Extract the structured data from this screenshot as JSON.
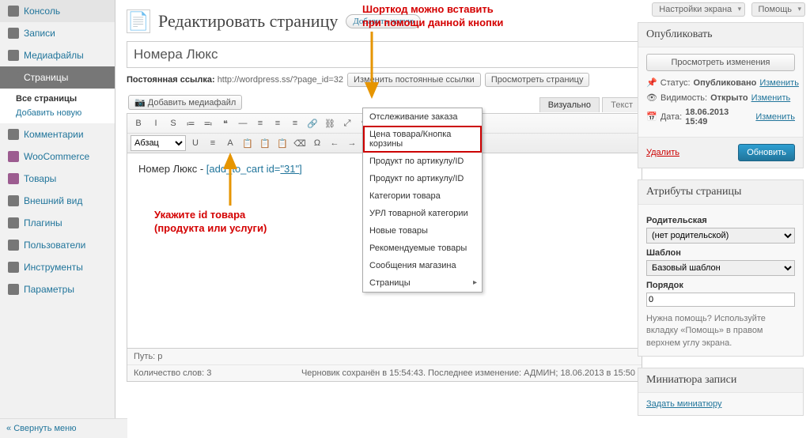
{
  "top": {
    "screen_options": "Настройки экрана",
    "help": "Помощь"
  },
  "menu": {
    "items": [
      {
        "label": "Консоль",
        "icon": "#777"
      },
      {
        "label": "Записи",
        "icon": "#777"
      },
      {
        "label": "Медиафайлы",
        "icon": "#777"
      },
      {
        "label": "Страницы",
        "icon": "#777",
        "current": true,
        "submenu": [
          {
            "label": "Все страницы",
            "b": true
          },
          {
            "label": "Добавить новую"
          }
        ]
      },
      {
        "label": "Комментарии",
        "icon": "#777"
      },
      {
        "label": "WooCommerce",
        "icon": "#9c5c90"
      },
      {
        "label": "Товары",
        "icon": "#9c5c90"
      },
      {
        "label": "Внешний вид",
        "icon": "#777"
      },
      {
        "label": "Плагины",
        "icon": "#777"
      },
      {
        "label": "Пользователи",
        "icon": "#777"
      },
      {
        "label": "Инструменты",
        "icon": "#777"
      },
      {
        "label": "Параметры",
        "icon": "#777"
      }
    ],
    "collapse": "Свернуть меню"
  },
  "header": {
    "title": "Редактировать страницу",
    "add_new": "Добавить новую"
  },
  "title_field": "Номера Люкс",
  "permalink": {
    "label": "Постоянная ссылка:",
    "url": "http://wordpress.ss/?page_id=32",
    "change": "Изменить постоянные ссылки",
    "view": "Просмотреть страницу"
  },
  "media_btn": "Добавить медиафайл",
  "tabs": {
    "visual": "Визуально",
    "text": "Текст"
  },
  "toolbar": {
    "row1": [
      "B",
      "I",
      "S",
      "≔",
      "≕",
      "❝",
      "―",
      "≡",
      "≡",
      "≡",
      "🔗",
      "⛓",
      "⤢",
      "✎",
      "✓",
      "▦",
      "⊞",
      "⊟"
    ],
    "format_select": "Абзац",
    "row2": [
      "U",
      "≡",
      "A",
      "📋",
      "📋",
      "📋",
      "⌫",
      "Ω",
      "←",
      "→",
      "¶",
      "↶",
      "↷",
      "?"
    ]
  },
  "content": {
    "text_before": "Номер Люкс - ",
    "shortcode_open": "[add_to_cart id=",
    "shortcode_id": "\"31\"",
    "shortcode_close": "]"
  },
  "dropdown": [
    {
      "label": "Отслеживание заказа"
    },
    {
      "label": "Цена товара/Кнопка корзины",
      "hl": true
    },
    {
      "label": "Продукт по артикулу/ID"
    },
    {
      "label": "Продукт по артикулу/ID"
    },
    {
      "label": "Категории товара"
    },
    {
      "label": "УРЛ товарной категории"
    },
    {
      "label": "Новые товары"
    },
    {
      "label": "Рекомендуемые товары"
    },
    {
      "label": "Сообщения магазина"
    },
    {
      "label": "Страницы",
      "arrow": true
    }
  ],
  "footer": {
    "path": "Путь: p",
    "words": "Количество слов: 3",
    "draft": "Черновик сохранён в 15:54:43. Последнее изменение: АДМИН; 18.06.2013 в 15:50"
  },
  "annotations": {
    "top": "Шорткод можно вставить\nпри помощи данной кнопки",
    "bottom": "Укажите id товара\n(продукта или услуги)"
  },
  "publish": {
    "box_title": "Опубликовать",
    "preview": "Просмотреть изменения",
    "status_label": "Статус:",
    "status_val": "Опубликовано",
    "status_edit": "Изменить",
    "vis_label": "Видимость:",
    "vis_val": "Открыто",
    "vis_edit": "Изменить",
    "date_label": "Дата:",
    "date_val": "18.06.2013 15:49",
    "date_edit": "Изменить",
    "delete": "Удалить",
    "update": "Обновить"
  },
  "attrs": {
    "box_title": "Атрибуты страницы",
    "parent_label": "Родительская",
    "parent_val": "(нет родительской)",
    "template_label": "Шаблон",
    "template_val": "Базовый шаблон",
    "order_label": "Порядок",
    "order_val": "0",
    "help": "Нужна помощь? Используйте вкладку «Помощь» в правом верхнем углу экрана."
  },
  "thumb": {
    "box_title": "Миниатюра записи",
    "link": "Задать миниатюру"
  }
}
